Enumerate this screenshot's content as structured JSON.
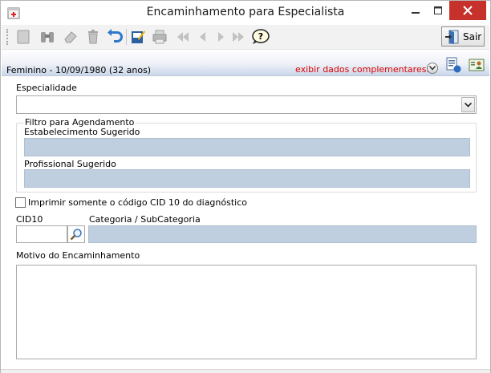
{
  "window": {
    "title": "Encaminhamento para Especialista"
  },
  "toolbar": {
    "buttons": [
      {
        "name": "new-icon"
      },
      {
        "name": "binoculars-icon"
      },
      {
        "name": "eraser-icon"
      },
      {
        "name": "trash-icon"
      },
      {
        "name": "undo-icon"
      },
      {
        "name": "edit-save-icon"
      },
      {
        "name": "printer-icon"
      },
      {
        "name": "first-record-icon"
      },
      {
        "name": "previous-record-icon"
      },
      {
        "name": "next-record-icon"
      },
      {
        "name": "last-record-icon"
      },
      {
        "name": "help-icon"
      }
    ],
    "exit_label": "Sair"
  },
  "patient_bar": {
    "patient_info": "Feminino - 10/09/1980 (32 anos)",
    "complement_link": "exibir dados complementares...",
    "link_color": "#e00000"
  },
  "form": {
    "specialty_label": "Especialidade",
    "specialty_value": "",
    "filter_group_title": "Filtro para Agendamento",
    "establishment_label": "Estabelecimento Sugerido",
    "establishment_value": "",
    "professional_label": "Profissional Sugerido",
    "professional_value": "",
    "print_cid_only_label": "Imprimir somente o código CID 10 do diagnóstico",
    "print_cid_only_checked": false,
    "cid_label": "CID10",
    "cid_value": "",
    "category_label": "Categoria / SubCategoria",
    "category_value": "",
    "reason_label": "Motivo do Encaminhamento",
    "reason_value": ""
  },
  "colors": {
    "readonly_field": "#bfcfdf",
    "close_button": "#c7312c"
  }
}
